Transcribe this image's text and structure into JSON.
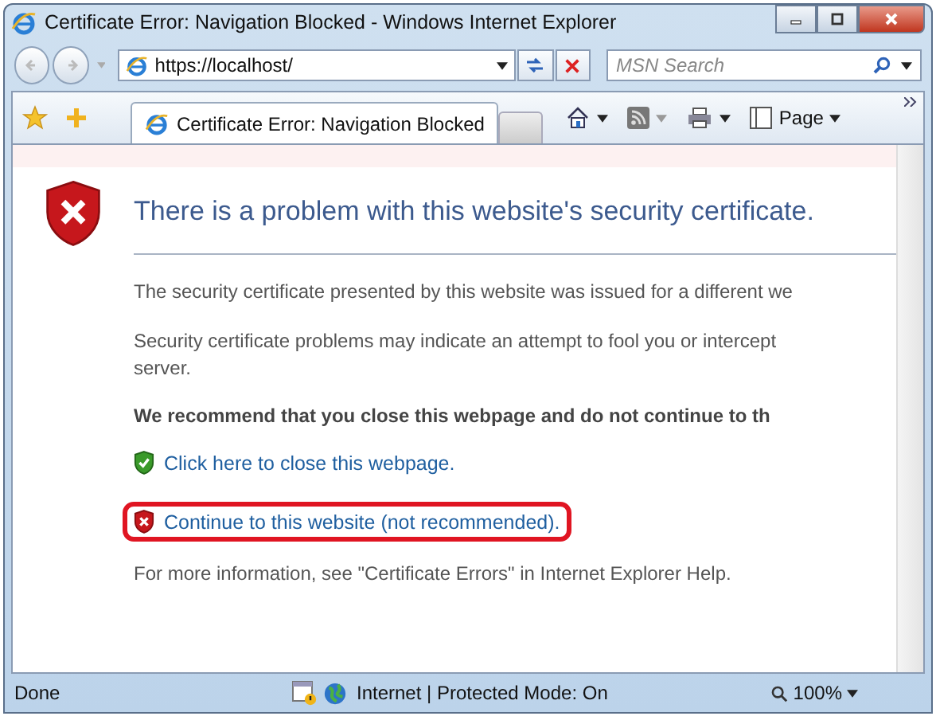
{
  "window": {
    "title": "Certificate Error: Navigation Blocked - Windows Internet Explorer"
  },
  "address_bar": {
    "value": "https://localhost/"
  },
  "search": {
    "placeholder": "MSN Search"
  },
  "tabs": [
    {
      "label": "Certificate Error: Navigation Blocked",
      "selected": true
    }
  ],
  "toolbar": {
    "page_menu": "Page"
  },
  "content": {
    "heading": "There is a problem with this website's security certificate.",
    "paragraphs": [
      {
        "lines": [
          "The security certificate presented by this website was issued for a different we"
        ]
      },
      {
        "lines": [
          "Security certificate problems may indicate an attempt to fool you or intercept",
          "server."
        ]
      }
    ],
    "recommendation": "We recommend that you close this webpage and do not continue to th",
    "links": [
      {
        "kind": "safe",
        "text": "Click here to close this webpage.",
        "highlighted": false
      },
      {
        "kind": "unsafe",
        "text": "Continue to this website (not recommended).",
        "highlighted": true
      }
    ],
    "more_info": "For more information, see \"Certificate Errors\" in Internet Explorer Help."
  },
  "status_bar": {
    "status": "Done",
    "zone": "Internet | Protected Mode: On",
    "zoom": "100%"
  }
}
